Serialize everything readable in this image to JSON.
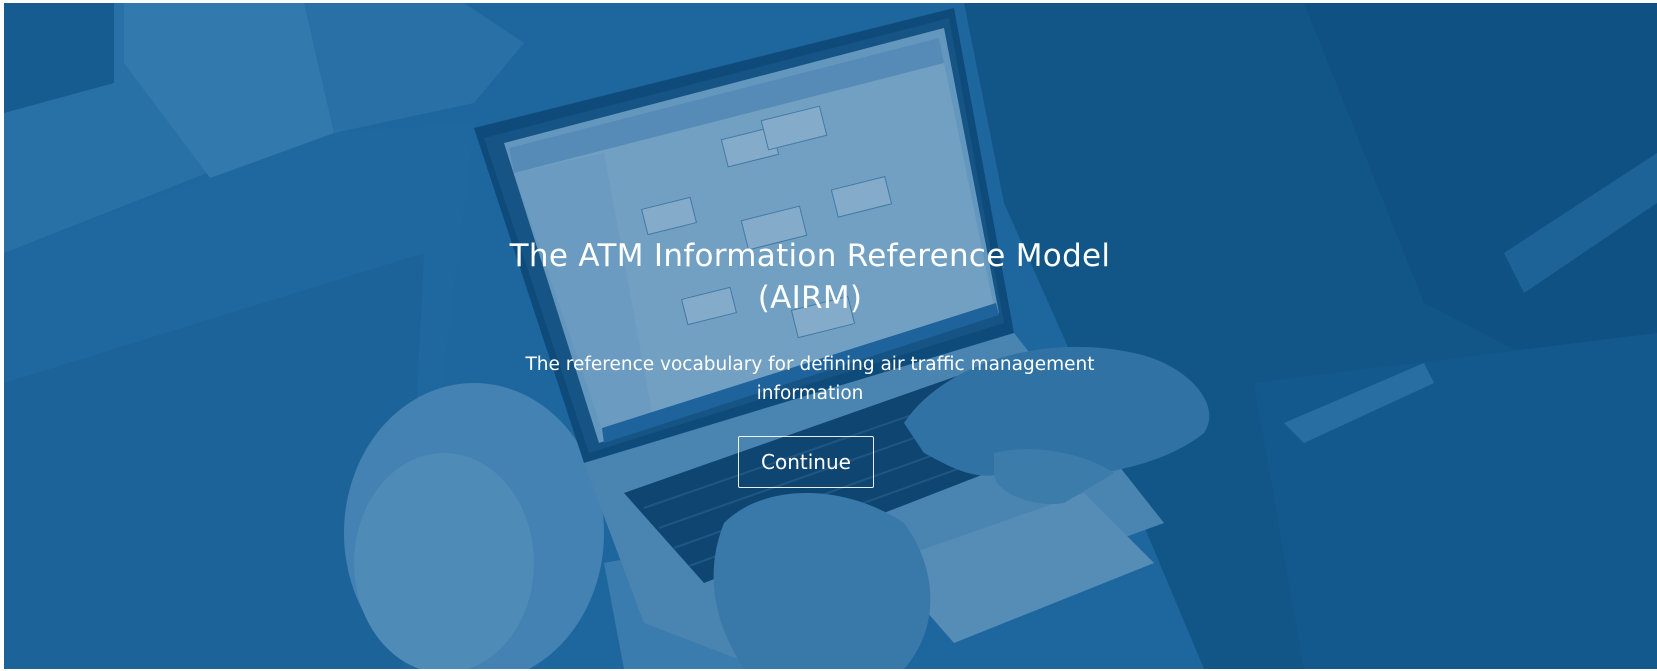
{
  "hero": {
    "title": "The ATM Information Reference Model (AIRM)",
    "subtitle": "The reference vocabulary for defining air traffic management information",
    "cta_label": "Continue",
    "overlay_color": "#1f6aa0",
    "background_image": "photo-laptop-with-uml-diagram"
  }
}
